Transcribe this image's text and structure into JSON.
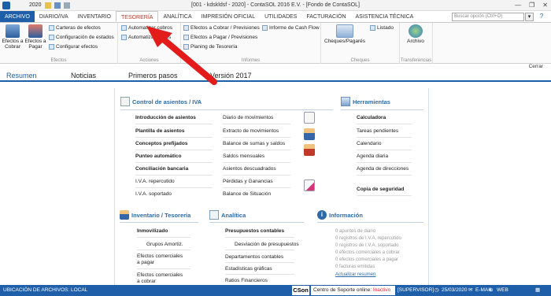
{
  "titlebar": {
    "year": "2020",
    "title": "[001 - kdskldsf - 2020] - ContaSOL 2016 E.V. - [Fondo de ContaSOL]",
    "minimize": "—",
    "restore": "❐",
    "close": "✕"
  },
  "menubar": {
    "items": [
      "ARCHIVO",
      "DIARIO/IVA",
      "INVENTARIO",
      "TESORERÍA",
      "ANALÍTICA",
      "IMPRESIÓN OFICIAL",
      "UTILIDADES",
      "FACTURACIÓN",
      "ASISTENCIA TÉCNICA"
    ],
    "active_index": 3,
    "search_placeholder": "Buscar opción (Ctrl+O)",
    "search_btn": "▾",
    "help": "?"
  },
  "ribbon": {
    "groups": [
      {
        "caption": "Efectos"
      },
      {
        "caption": "Acciones"
      },
      {
        "caption": "Informes"
      },
      {
        "caption": "Cheques"
      },
      {
        "caption": "Transferencias"
      }
    ],
    "efectos_cobrar": "Efectos a Cobrar",
    "efectos_pagar": "Efectos a Pagar",
    "carteras": "Carteras de efectos",
    "config_estados": "Configuración de estados",
    "config_efectos": "Configurar efectos",
    "automatizar_cobros": "Automatizar cobros",
    "automatizar_pagos": "Automatizar pagos",
    "ef_cobrar_prev": "Efectos a Cobrar / Previsiones",
    "ef_pagar_prev": "Efectos a Pagar / Previsiones",
    "planing": "Planing de Tesorería",
    "informe_cash": "Informe de Cash Flow",
    "cheques_pagares": "Cheques/Pagarés",
    "listado": "Listado",
    "archivo": "Archivo",
    "close_link": "Cerrar"
  },
  "tabs": [
    "Resumen",
    "Noticias",
    "Primeros pasos",
    "Versión 2017"
  ],
  "sections": {
    "control": {
      "title": "Control de asientos / IVA",
      "left": [
        "Introducción de asientos",
        "Plantilla de asientos",
        "Conceptos prefijados",
        "Punteo automático",
        "Conciliación bancaria",
        "I.V.A. repercutido",
        "I.V.A. soportado"
      ],
      "right": [
        "Diario de movimientos",
        "Extracto de movimientos",
        "Balance de sumas y saldos",
        "Saldos mensuales",
        "Asientos descuadrados",
        "Pérdidas y Ganancias",
        "Balance de Situación"
      ]
    },
    "herramientas": {
      "title": "Herramientas",
      "items": [
        "Calculadora",
        "Tareas pendientes",
        "Calendario",
        "Agenda diaria",
        "Agenda de direcciones",
        "Copia de seguridad"
      ]
    },
    "inventario": {
      "title": "Inventario / Tesorería",
      "items": [
        "Inmovilizado",
        "Grupos Amortiz.",
        "Efectos comerciales a pagar",
        "Efectos comerciales a cobrar"
      ]
    },
    "analitica": {
      "title": "Analítica",
      "items": [
        "Presupuestos contables",
        "Desviación de presupuestos",
        "Departamentos contables",
        "Estadísticas gráficas",
        "Ratios Financieros"
      ]
    },
    "informacion": {
      "title": "Información",
      "items": [
        "0 apuntes de diario",
        "0 registros de I.V.A. repercutido",
        "0 registros de I.V.A. soportado",
        "0 efectos comerciales a cobrar",
        "0 efectos comerciales a pagar",
        "0 facturas emitidas"
      ],
      "link": "Actualizar resumen"
    }
  },
  "statusbar": {
    "location": "UBICACIÓN DE ARCHIVOS: LOCAL",
    "cson": "CSon",
    "support_label": "Centro de Soporte online:",
    "support_state": "Inactivo",
    "user": "[SUPERVISOR]",
    "date": "25/03/2020",
    "email": "E-MAIL",
    "web": "WEB"
  },
  "colors": {
    "accent": "#1f5fa9",
    "section_title": "#2d6aa8",
    "annotation_arrow": "#e31b1b"
  }
}
